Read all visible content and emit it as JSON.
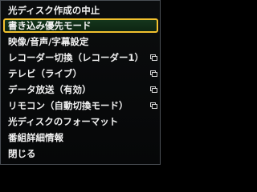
{
  "menu": {
    "items": [
      {
        "label": "光ディスク作成の中止",
        "has_submenu": false,
        "selected": false
      },
      {
        "label": "書き込み優先モード",
        "has_submenu": false,
        "selected": true
      },
      {
        "label": "映像/音声/字幕設定",
        "has_submenu": false,
        "selected": false
      },
      {
        "label": "レコーダー切換（レコーダー1）",
        "has_submenu": true,
        "selected": false
      },
      {
        "label": "テレビ（ライブ）",
        "has_submenu": true,
        "selected": false
      },
      {
        "label": "データ放送（有効）",
        "has_submenu": true,
        "selected": false
      },
      {
        "label": "リモコン（自動切換モード）",
        "has_submenu": true,
        "selected": false
      },
      {
        "label": "光ディスクのフォーマット",
        "has_submenu": false,
        "selected": false
      },
      {
        "label": "番組詳細情報",
        "has_submenu": false,
        "selected": false
      },
      {
        "label": "閉じる",
        "has_submenu": false,
        "selected": false
      }
    ],
    "colors": {
      "background": "#060708",
      "text": "#f2f2f2",
      "selection_border": "#f2c12e",
      "selection_fill": "#15361c"
    }
  }
}
